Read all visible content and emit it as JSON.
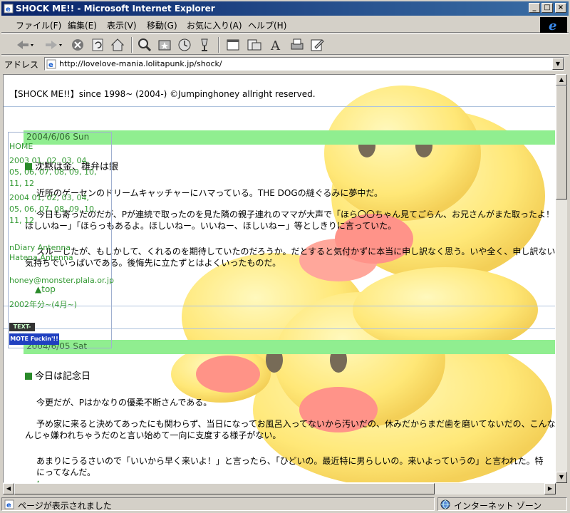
{
  "window": {
    "title": "SHOCK ME!! - Microsoft Internet Explorer",
    "minimize": "_",
    "maximize": "□",
    "close": "×"
  },
  "menu": [
    "ファイル(F)",
    "編集(E)",
    "表示(V)",
    "移動(G)",
    "お気に入り(A)",
    "ヘルプ(H)"
  ],
  "toolbar_icons": [
    "back-icon",
    "forward-icon",
    "stop-icon",
    "refresh-icon",
    "home-icon",
    "search-icon",
    "favorites-icon",
    "history-icon",
    "channels-icon",
    "fullscreen-icon",
    "mail-icon",
    "font-icon",
    "print-icon",
    "edit-icon"
  ],
  "address": {
    "label": "アドレス",
    "url": "http://lovelove-mania.lolitapunk.jp/shock/"
  },
  "page": {
    "copyright": "【SHOCK ME!!】since 1998~ (2004-) ©Jumpinghoney allright reserved.",
    "sidebar": {
      "home": "HOME",
      "y2003": "2003 01, 02, 03, 04,",
      "y2003b": "05, 06, 07, 08, 09, 10,",
      "y2003c": "11, 12",
      "y2004": "2004 01, 02, 03, 04,",
      "y2004b": "05, 06, 07, 08, 09, 10,",
      "y2004c": "11, 12",
      "antenna1": "nDiary Antenna",
      "antenna2": "Hatena Antenna",
      "email": "honey@monster.plala.or.jp",
      "archive": "2002年分~(4月~)",
      "badge_textan": "TEXT-AN",
      "badge_mote": "MOTE Fuckin'!!"
    },
    "entries": [
      {
        "date": "2004/6/06 Sun",
        "heading": "沈黙は金、雄弁は銀",
        "paragraphs": [
          "近所のゲーセンのドリームキャッチャーにハマっている。THE DOGの縫ぐるみに夢中だ。",
          "今日も寄ったのだが、Pが連続で取ったのを見た隣の親子連れのママが大声で「ほら〇〇ちゃん見てごらん、お兄さんがまた取ったよ！ほしいねー」「ほらっもあるよ。ほしいねー。いいねー、ほしいねー」等としきりに言っていた。",
          "スルーしたが、もしかして、くれるのを期待していたのだろうか。だとすると気付かずに本当に申し訳なく思う。いや全く、申し訳ない気持ちでいっぱいである。後悔先に立たずとはよくいったものだ。"
        ],
        "top_link": "top"
      },
      {
        "date": "2004/6/05 Sat",
        "heading": "今日は記念日",
        "paragraphs": [
          "今更だが、Pはかなりの優柔不断さんである。",
          "予め家に来ると決めてあったにも関わらず、当日になってお風呂入ってないから汚いだの、休みだからまだ歯を磨いてないだの、こんなんじゃ嫌われちゃうだのと言い始めて一向に支度する様子がない。",
          "あまりにうるさいので「いいから早く来いよ！」と言ったら、「ひどいの。最近特に男らしいの。来いよっていうの」と言われた。特にってなんだ。"
        ]
      }
    ]
  },
  "status": {
    "text": "ページが表示されました",
    "zone": "インターネット ゾーン"
  },
  "colors": {
    "title_bar": "#0a246a",
    "date_bar": "#90ee90",
    "link_green": "#339933"
  }
}
